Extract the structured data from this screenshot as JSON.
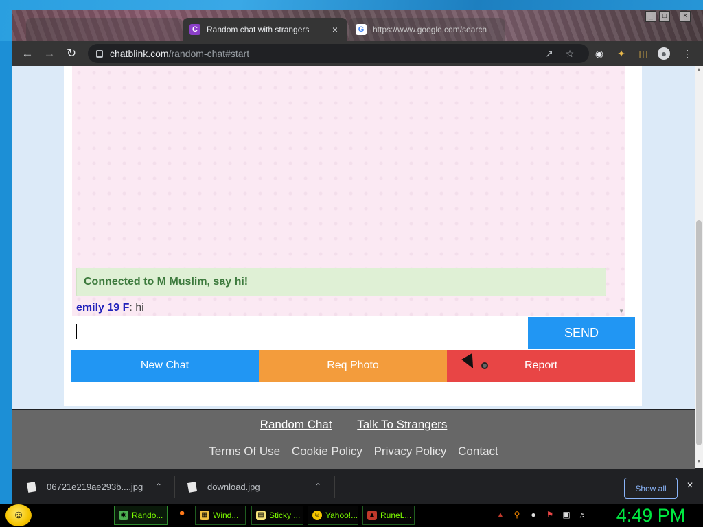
{
  "browser": {
    "tabs": [
      {
        "title": "",
        "active": false
      },
      {
        "title": "Random chat with strangers",
        "active": true,
        "close": "×"
      },
      {
        "title": "https://www.google.com/search",
        "active": false
      }
    ],
    "window_controls": [
      "_",
      "□",
      "×"
    ],
    "url_host": "chatblink.com",
    "url_path": "/random-chat#start"
  },
  "chat": {
    "system_message": "Connected to M Muslim, say hi!",
    "messages": [
      {
        "sender": "emily 19 F",
        "separator": ": ",
        "text": "hi"
      }
    ],
    "input_value": "",
    "send_label": "SEND"
  },
  "actions": {
    "new_chat": "New Chat",
    "req_photo": "Req Photo",
    "report": "Report"
  },
  "footer": {
    "links": [
      "Random Chat",
      "Talk To Strangers"
    ],
    "nav": [
      "Terms Of Use",
      "Cookie Policy",
      "Privacy Policy",
      "Contact"
    ]
  },
  "downloads": {
    "items": [
      "06721e219ae293b....jpg",
      "download.jpg"
    ],
    "show_all": "Show all"
  },
  "taskbar": {
    "items": [
      "Rando...",
      "Wind...",
      "Sticky ...",
      "Yahoo!...",
      "RuneL..."
    ],
    "clock": "4:49 PM"
  },
  "colors": {
    "send": "#2196f3",
    "new_chat": "#2196f3",
    "req_photo": "#f39c3c",
    "report": "#e84545",
    "system_message_bg": "#dff0d5",
    "clock": "#00e640"
  }
}
